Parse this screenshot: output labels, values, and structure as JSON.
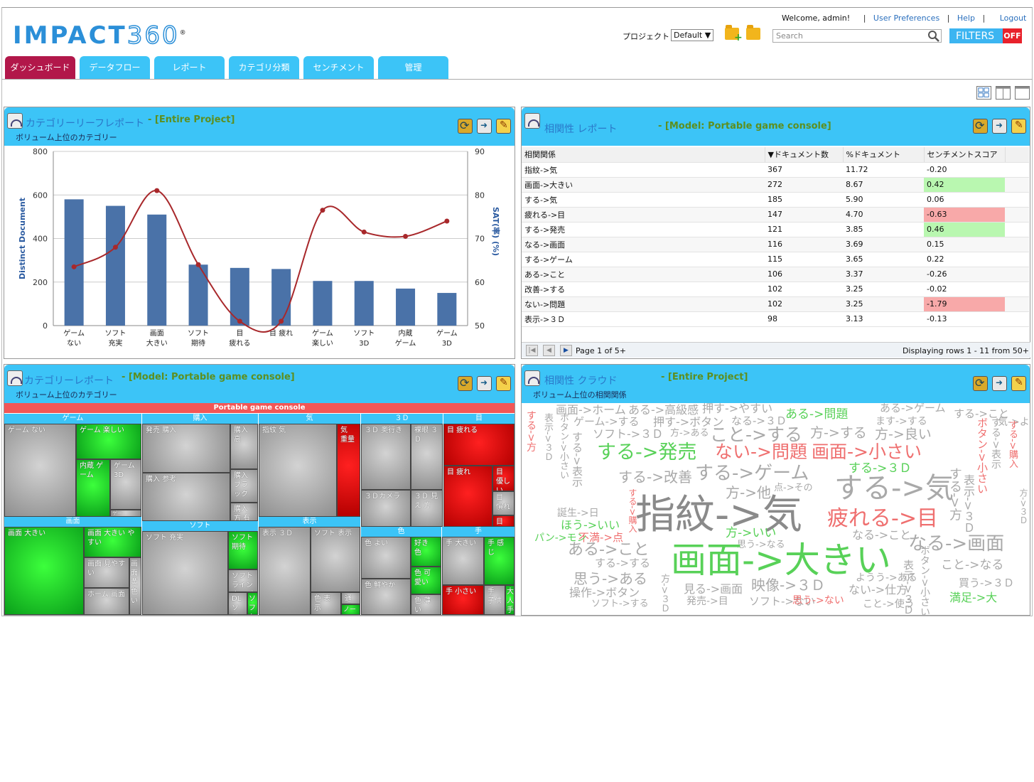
{
  "brand": {
    "logo_main": "IMPACT",
    "logo_num": "360",
    "logo_reg": "®"
  },
  "top_links": {
    "welcome": "Welcome, admin!",
    "sep": "|",
    "prefs": "User Preferences",
    "help": "Help",
    "logout": "Logout"
  },
  "project": {
    "label": "プロジェクト :",
    "value": "Default ▼"
  },
  "search": {
    "placeholder": "Search"
  },
  "filters": {
    "label": "FILTERS",
    "state": "OFF"
  },
  "tabs": [
    "ダッシュボード",
    "データフロー",
    "レポート",
    "カテゴリ分類",
    "センチメント",
    "管理"
  ],
  "panels": {
    "leaf": {
      "title": "カテゴリーリーフレポート",
      "model": "- [Entire Project]",
      "sub": "ボリューム上位のカテゴリー"
    },
    "corr": {
      "title": "相関性 レポート",
      "model": "- [Model: Portable game console]"
    },
    "cat": {
      "title": "カテゴリーレポート",
      "model": "- [Model: Portable game console]",
      "sub": "ボリューム上位のカテゴリー"
    },
    "cloud": {
      "title": "相関性 クラウド",
      "model": "- [Entire Project]",
      "sub": "ボリューム上位の相関関係"
    }
  },
  "chart_data": {
    "type": "bar",
    "categories": [
      "ゲーム\nない",
      "ソフト\n充実",
      "画面\n大きい",
      "ソフト\n期待",
      "目\n疲れる",
      "目 疲れ",
      "ゲーム\n楽しい",
      "ソフト\n3D",
      "内蔵\nゲーム",
      "ゲーム\n3D"
    ],
    "series": [
      {
        "name": "",
        "type": "bar",
        "axis": "left",
        "color": "#4a72a8",
        "values": [
          580,
          550,
          510,
          280,
          265,
          260,
          205,
          205,
          170,
          150
        ]
      },
      {
        "name": "",
        "type": "line",
        "axis": "right",
        "color": "#a8282b",
        "values": [
          63.5,
          68,
          81,
          64,
          51,
          51,
          76.5,
          71.5,
          70.5,
          74
        ]
      }
    ],
    "ylabel": "Distinct Document",
    "y2label": "SAT(率) (%)",
    "ylim": [
      0,
      800
    ],
    "y2lim": [
      50,
      90
    ],
    "yticks": [
      0,
      200,
      400,
      600,
      800
    ],
    "y2ticks": [
      50,
      60,
      70,
      80,
      90
    ],
    "grid": true
  },
  "corr_table": {
    "headers": [
      "相関関係",
      "▼ドキュメント数",
      "%ドキュメント",
      "センチメントスコア"
    ],
    "rows": [
      {
        "rel": "指紋->気",
        "count": "367",
        "pct": "11.72",
        "score": "-0.20",
        "color": ""
      },
      {
        "rel": "画面->大きい",
        "count": "272",
        "pct": "8.67",
        "score": "0.42",
        "color": "#b9f7b0"
      },
      {
        "rel": "する->気",
        "count": "185",
        "pct": "5.90",
        "score": "0.06",
        "color": ""
      },
      {
        "rel": "疲れる->目",
        "count": "147",
        "pct": "4.70",
        "score": "-0.63",
        "color": "#f8a9a9"
      },
      {
        "rel": "する->発売",
        "count": "121",
        "pct": "3.85",
        "score": "0.46",
        "color": "#b9f7b0"
      },
      {
        "rel": "なる->画面",
        "count": "116",
        "pct": "3.69",
        "score": "0.15",
        "color": ""
      },
      {
        "rel": "する->ゲーム",
        "count": "115",
        "pct": "3.65",
        "score": "0.22",
        "color": ""
      },
      {
        "rel": "ある->こと",
        "count": "106",
        "pct": "3.37",
        "score": "-0.26",
        "color": ""
      },
      {
        "rel": "改善->する",
        "count": "102",
        "pct": "3.25",
        "score": "-0.02",
        "color": ""
      },
      {
        "rel": "ない->問題",
        "count": "102",
        "pct": "3.25",
        "score": "-1.79",
        "color": "#f8a9a9"
      },
      {
        "rel": "表示->３Ｄ",
        "count": "98",
        "pct": "3.13",
        "score": "-0.13",
        "color": ""
      }
    ],
    "page": "Page 1 of 5+",
    "rows_info": "Displaying rows 1 - 11 from 50+"
  },
  "treemap": {
    "root": "Portable game console",
    "groups": [
      "ゲーム",
      "購入",
      "気",
      "３Ｄ",
      "目",
      "画面",
      "ソフト",
      "表示",
      "色",
      "手"
    ],
    "cells": [
      "ゲーム ない",
      "ゲーム 楽しい",
      "内蔵 ゲーム",
      "ゲーム 3D",
      "ゲー",
      "発売 購入",
      "購入 高",
      "購入 参考",
      "購入 ブラック",
      "購入 方 有無",
      "指紋 気",
      "気 重量",
      "３Ｄ 奥行き",
      "裸眼 ３Ｄ",
      "３Ｄカメラ",
      "３Ｄ 見え 方",
      "目 疲れる",
      "目 疲れ",
      "目 優しい",
      "目 慣れ",
      "目 負",
      "画面 大きい",
      "画面 大きい やすい",
      "画面 見やすい",
      "画面 黄色い",
      "ホーム 画面",
      "画面 色",
      "ソフト 充実",
      "ソフト 期待",
      "ソフト ラインナップ",
      "DL ソフト",
      "ソフト",
      "表示 ３Ｄ",
      "ソフト 表示",
      "色 表示",
      "通常",
      "ノーマル",
      "色 よい",
      "好き 色",
      "色 可愛い",
      "色 鮮やか",
      "色 薄い",
      "手 大きい",
      "手 感じ",
      "手 小さい",
      "手 子供",
      "大人 手"
    ]
  },
  "cloud_words": [
    "画面->ホーム",
    "ある->高級感",
    "押す->やすい",
    "ある->ゲーム",
    "ゲーム->する",
    "押す->ボタン",
    "なる->３Ｄ",
    "ある->問題",
    "ます->する",
    "する->こと",
    "ソフト->３Ｄ",
    "方->ある",
    "こと->する",
    "方->する",
    "方->良い",
    "気->ような",
    "する->発売",
    "ない->問題",
    "画面->小さい",
    "する->３Ｄ",
    "する->改善",
    "する->ゲーム",
    "点->その",
    "する->気",
    "方->他",
    "指紋->気",
    "疲れる->目",
    "方->いい",
    "なる->こと",
    "思う->なる",
    "ある->こと",
    "なる->画面",
    "する->する",
    "画面->大きい",
    "思う->ある",
    "ようう->ある",
    "こと->なる",
    "買う->３Ｄ",
    "操作->ボタン",
    "見る->画面",
    "映像->３Ｄ",
    "ない->仕方",
    "ソフト->する",
    "発売->目",
    "ソフト->ない",
    "思う->ない",
    "こと->使う",
    "満足->大",
    "不満->点",
    "ほう->いい",
    "誕生->日",
    "パン->モン",
    "する->方",
    "表示->３Ｄ",
    "ボタン->小さい",
    "する->表示",
    "する->購入",
    "方->３Ｄ"
  ]
}
